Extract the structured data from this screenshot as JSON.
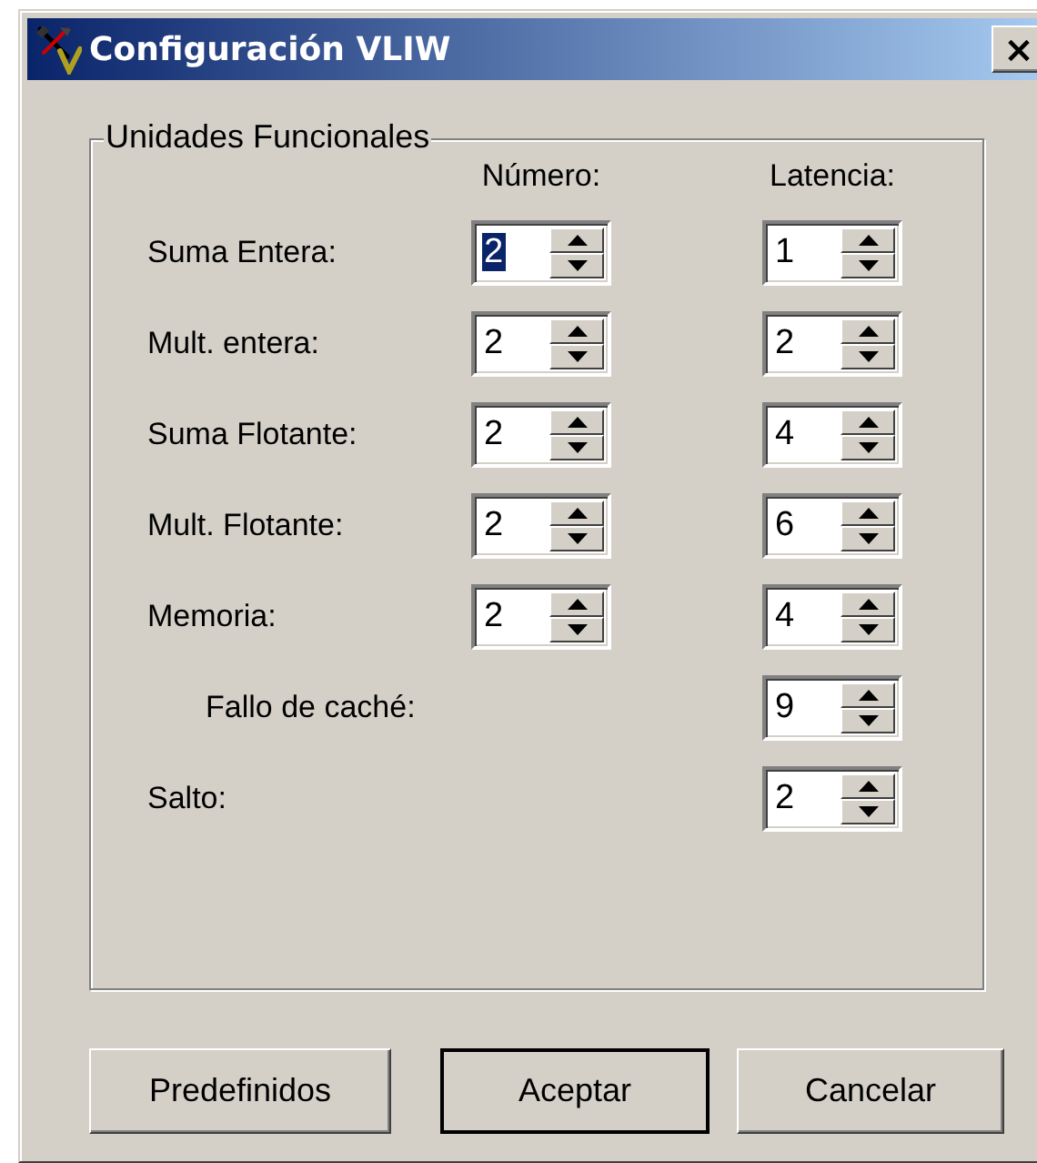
{
  "window": {
    "title": "Configuración VLIW",
    "close": "×"
  },
  "group": {
    "title": "Unidades Funcionales",
    "columns": [
      "Número:",
      "Latencia:"
    ],
    "rows": [
      {
        "kind": "unit",
        "label": "Suma Entera:",
        "number": {
          "value": "2",
          "focused": true
        },
        "latency": "1"
      },
      {
        "kind": "unit",
        "label": "Mult. entera:",
        "number": {
          "value": "2",
          "focused": false
        },
        "latency": "2"
      },
      {
        "kind": "unit",
        "label": "Suma Flotante:",
        "number": {
          "value": "2",
          "focused": false
        },
        "latency": "4"
      },
      {
        "kind": "unit",
        "label": "Mult. Flotante:",
        "number": {
          "value": "2",
          "focused": false
        },
        "latency": "6"
      },
      {
        "kind": "unit",
        "label": "Memoria:",
        "number": {
          "value": "2",
          "focused": false
        },
        "latency": "4"
      },
      {
        "kind": "sub",
        "label": "Fallo de caché:",
        "latency": "9"
      },
      {
        "kind": "single",
        "label": "Salto:",
        "latency": "2"
      }
    ]
  },
  "buttons": [
    {
      "label": "Predefinidos",
      "default": false
    },
    {
      "label": "Aceptar",
      "default": true
    },
    {
      "label": "Cancelar",
      "default": false
    }
  ]
}
